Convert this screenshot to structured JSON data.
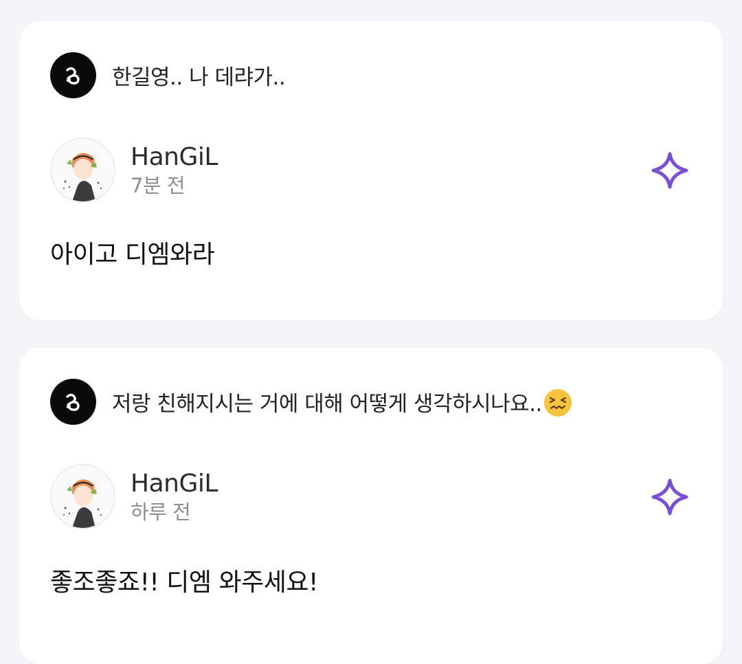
{
  "colors": {
    "page_background": "#f5f5f7",
    "card_background": "#ffffff",
    "sparkle_accent": "#7b4fd1",
    "asker_icon_background": "#0a0a0a"
  },
  "posts": [
    {
      "question": "한길영.. 나 데랴가..",
      "question_emoji": "",
      "author": "HanGiL",
      "time": "7분 전",
      "answer": "아이고 디엠와라",
      "action_icon": "sparkle-icon"
    },
    {
      "question": "저랑 친해지시는 거에 대해 어떻게 생각하시나요..",
      "question_emoji": "confounded-face-emoji",
      "author": "HanGiL",
      "time": "하루 전",
      "answer": "좋조좋죠!! 디엠 와주세요!",
      "action_icon": "sparkle-icon"
    }
  ]
}
